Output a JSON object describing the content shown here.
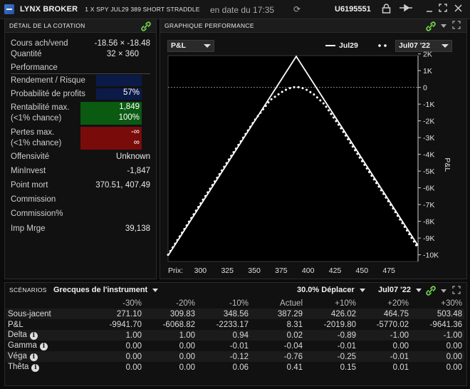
{
  "titlebar": {
    "brand": "LYNX BROKER",
    "instrument": "1 X SPY JUL29 389 SHORT STRADDLE",
    "date_label": "en date du 17:35",
    "account": "U6195551"
  },
  "quote_panel": {
    "header": "DÉTAIL DE LA COTATION",
    "bid_ask_label": "Cours ach/vend",
    "bid_ask_value": "-18.56 × -18.48",
    "quantity_label": "Quantité",
    "quantity_value": "32 × 360",
    "performance_label": "Performance",
    "rr_label": "Rendement / Risque",
    "rr_value": "",
    "prob_label": "Probabilité de profits",
    "prob_value": "57%",
    "max_profit_label": "Rentabilité max.",
    "max_profit_value": "1,849",
    "max_profit_sub_label": "(<1% chance)",
    "max_profit_sub_value": "100%",
    "max_loss_label": "Pertes max.",
    "max_loss_value": "-∞",
    "max_loss_sub_label": "(<1% chance)",
    "max_loss_sub_value": "∞",
    "offensive_label": "Offensivité",
    "offensive_value": "Unknown",
    "mininvest_label": "MinInvest",
    "mininvest_value": "-1,847",
    "breakeven_label": "Point mort",
    "breakeven_value": "370.51, 407.49",
    "commission_label": "Commission",
    "commission_pct_label": "Commission%",
    "imp_marge_label": "Imp Mrge",
    "imp_marge_value": "39,138"
  },
  "chart_panel": {
    "header": "GRAPHIQUE PERFORMANCE",
    "metric_select": "P&L",
    "legend_solid": "Jul29",
    "date_select": "Jul07 '22",
    "x_axis_prefix": "Prix:"
  },
  "chart_data": {
    "type": "line",
    "xlabel": "Prix:",
    "ylabel": "P&L",
    "xlim": [
      270,
      502
    ],
    "ylim": [
      -10.4,
      1.9
    ],
    "x_ticks": [
      300,
      325,
      350,
      375,
      400,
      425,
      450,
      475
    ],
    "y_ticks": [
      2,
      1,
      0,
      -1,
      -2,
      -3,
      -4,
      -5,
      -6,
      -7,
      -8,
      -9,
      -10
    ],
    "y_tick_labels": [
      "2K",
      "1K",
      "0",
      "-1K",
      "-2K",
      "-3K",
      "-4K",
      "-5K",
      "-6K",
      "-7K",
      "-8K",
      "-9K",
      "-10K"
    ],
    "series": [
      {
        "name": "Jul29",
        "style": "solid",
        "x": [
          270,
          389,
          502
        ],
        "y": [
          -10.05,
          1.85,
          -9.45
        ]
      },
      {
        "name": "Jul07 '22",
        "style": "dotted",
        "x": [
          270,
          300,
          330,
          350,
          365,
          375,
          380,
          385,
          389,
          393,
          398,
          405,
          415,
          430,
          450,
          480,
          502
        ],
        "y": [
          -10.0,
          -6.95,
          -3.95,
          -2.0,
          -0.75,
          -0.3,
          -0.12,
          0.0,
          0.02,
          0.0,
          -0.12,
          -0.4,
          -1.0,
          -2.4,
          -4.4,
          -7.35,
          -9.6
        ]
      }
    ],
    "colors": {
      "line": "#ffffff",
      "zero_line": "#888888",
      "background": "#000000"
    }
  },
  "scenarios": {
    "header": "SCÉNARIOS",
    "greeks_select": "Grecques de l'instrument",
    "shift_select": "30.0% Déplacer",
    "date_select": "Jul07 '22",
    "columns": [
      "-30%",
      "-20%",
      "-10%",
      "Actuel",
      "+10%",
      "+20%",
      "+30%"
    ],
    "rows": [
      {
        "label": "Sous-jacent",
        "info": false,
        "values": [
          "271.10",
          "309.83",
          "348.56",
          "387.29",
          "426.02",
          "464.75",
          "503.48"
        ]
      },
      {
        "label": "P&L",
        "info": false,
        "values": [
          "-9941.70",
          "-6068.82",
          "-2233.17",
          "8.31",
          "-2019.80",
          "-5770.02",
          "-9641.36"
        ]
      },
      {
        "label": "Delta",
        "info": true,
        "values": [
          "1.00",
          "1.00",
          "0.94",
          "0.02",
          "-0.89",
          "-1.00",
          "-1.00"
        ]
      },
      {
        "label": "Gamma",
        "info": true,
        "values": [
          "0.00",
          "0.00",
          "-0.01",
          "-0.04",
          "-0.01",
          "0.00",
          "0.00"
        ]
      },
      {
        "label": "Véga",
        "info": true,
        "values": [
          "0.00",
          "0.00",
          "-0.12",
          "-0.76",
          "-0.25",
          "-0.01",
          "0.00"
        ]
      },
      {
        "label": "Thêta",
        "info": true,
        "values": [
          "0.00",
          "0.00",
          "0.06",
          "0.41",
          "0.15",
          "0.01",
          "0.00"
        ]
      }
    ]
  }
}
